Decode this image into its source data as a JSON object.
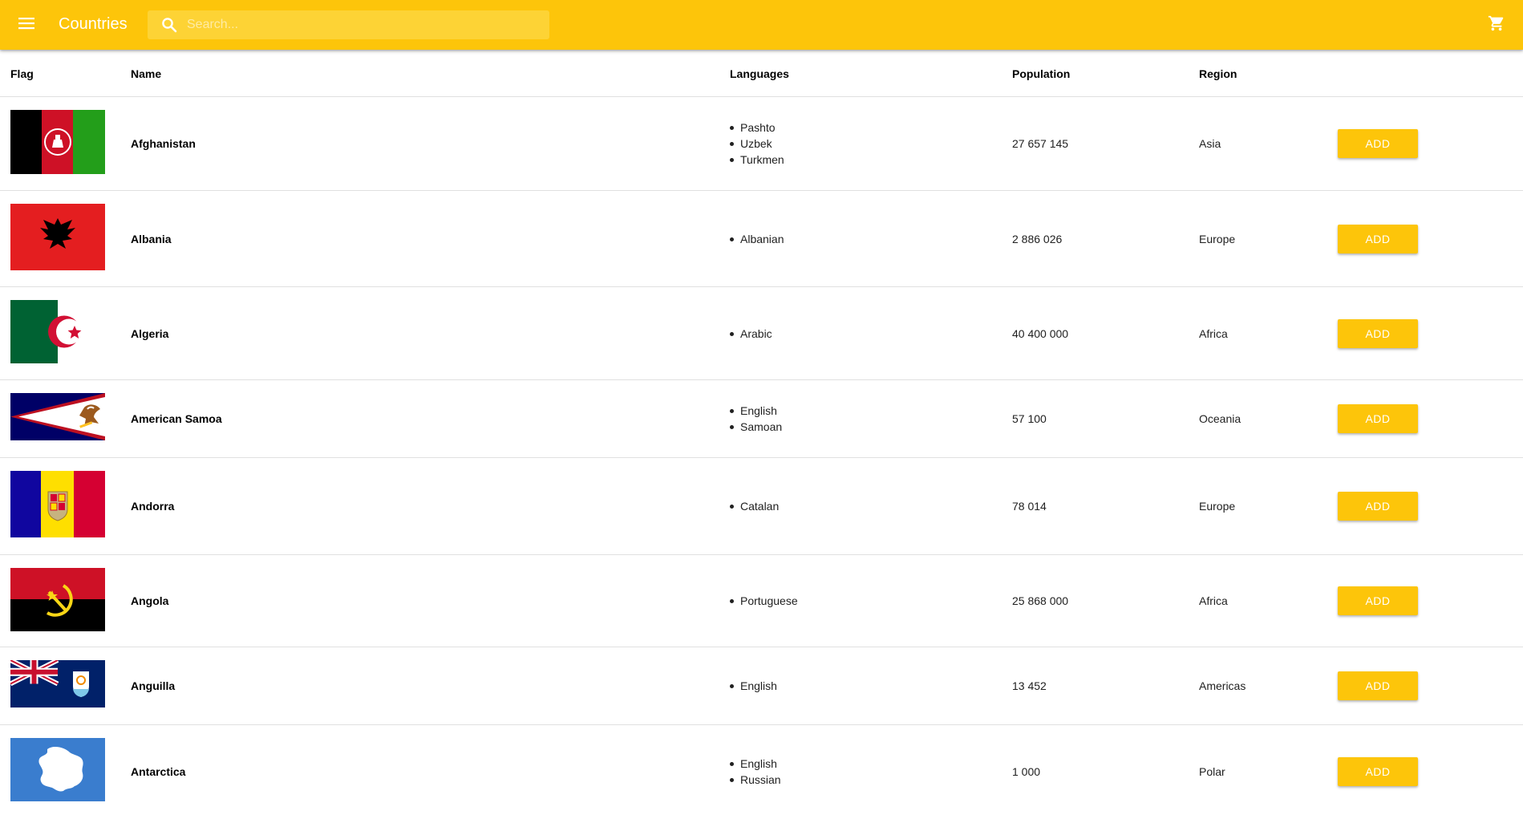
{
  "app": {
    "title": "Countries",
    "search_placeholder": "Search...",
    "icons": {
      "menu": "menu-icon",
      "search": "search-icon",
      "cart": "shopping-cart-icon"
    },
    "colors": {
      "primary": "#FDC50A",
      "search_bg": "#FDD335",
      "text": "#212121"
    }
  },
  "table": {
    "headers": {
      "flag": "Flag",
      "name": "Name",
      "languages": "Languages",
      "population": "Population",
      "region": "Region"
    },
    "add_label": "ADD",
    "rows": [
      {
        "name": "Afghanistan",
        "languages": [
          "Pashto",
          "Uzbek",
          "Turkmen"
        ],
        "population": "27 657 145",
        "region": "Asia",
        "flag": "afghanistan-flag"
      },
      {
        "name": "Albania",
        "languages": [
          "Albanian"
        ],
        "population": "2 886 026",
        "region": "Europe",
        "flag": "albania-flag"
      },
      {
        "name": "Algeria",
        "languages": [
          "Arabic"
        ],
        "population": "40 400 000",
        "region": "Africa",
        "flag": "algeria-flag"
      },
      {
        "name": "American Samoa",
        "languages": [
          "English",
          "Samoan"
        ],
        "population": "57 100",
        "region": "Oceania",
        "flag": "american-samoa-flag"
      },
      {
        "name": "Andorra",
        "languages": [
          "Catalan"
        ],
        "population": "78 014",
        "region": "Europe",
        "flag": "andorra-flag"
      },
      {
        "name": "Angola",
        "languages": [
          "Portuguese"
        ],
        "population": "25 868 000",
        "region": "Africa",
        "flag": "angola-flag"
      },
      {
        "name": "Anguilla",
        "languages": [
          "English"
        ],
        "population": "13 452",
        "region": "Americas",
        "flag": "anguilla-flag"
      },
      {
        "name": "Antarctica",
        "languages": [
          "English",
          "Russian"
        ],
        "population": "1 000",
        "region": "Polar",
        "flag": "antarctica-flag"
      }
    ]
  }
}
